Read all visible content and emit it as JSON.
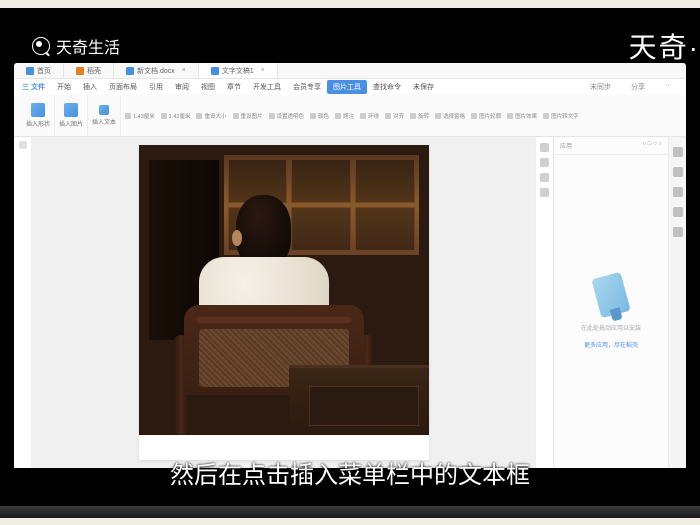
{
  "watermark": {
    "left": "天奇生活",
    "right": "天奇·"
  },
  "tabs": [
    {
      "label": "首页"
    },
    {
      "label": "稻壳"
    },
    {
      "label": "新文档.docx"
    },
    {
      "label": "文字文稿1"
    }
  ],
  "menu": {
    "logo": "三 文件",
    "items": [
      "开始",
      "插入",
      "页面布局",
      "引用",
      "审阅",
      "视图",
      "章节",
      "开发工具",
      "会员专享"
    ],
    "active": "图片工具",
    "right_items": [
      "查找命令",
      "未保存"
    ],
    "far_right": [
      "未同步",
      "分享",
      "···"
    ]
  },
  "toolbar": {
    "groups": [
      "插入形状",
      "插入图片",
      "插入文本"
    ],
    "mid_items": [
      "1.43厘米",
      "1.43厘米",
      "重设大小",
      "重设图片",
      "设置透明色",
      "颜色",
      "题注",
      "环绕",
      "对齐",
      "旋转",
      "选择窗格",
      "图片轮廓",
      "图片效果",
      "图片转文字"
    ]
  },
  "sidebar": {
    "title": "应用",
    "icons": [
      "○",
      "□",
      "○",
      "○"
    ],
    "empty_text": "在此处拖动应用以安装",
    "link": "更多应用，尽在稻壳"
  },
  "subtitle": "然后在点击插入菜单栏中的文本框"
}
